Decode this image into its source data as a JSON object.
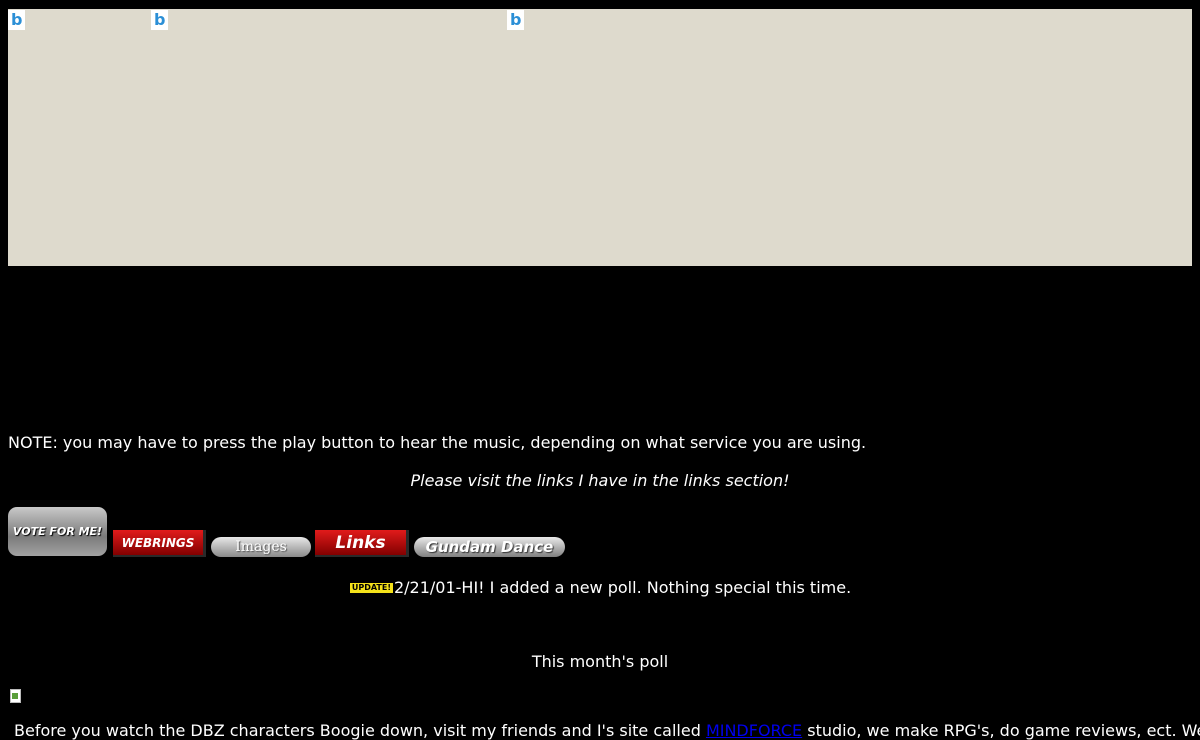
{
  "banner": {
    "background_color": "#dedacd",
    "icons": [
      "bing-icon",
      "bing-icon",
      "bing-icon"
    ],
    "icon_glyph": "b"
  },
  "note_text": "NOTE: you may have to press the play button to hear the music, depending on what service you are using.",
  "visit_text": "Please visit the links I have in the links section!",
  "nav_buttons": {
    "vote": "VOTE FOR ME!",
    "webrings": "WEBRINGS",
    "images": "Images",
    "links": "Links",
    "gundam": "Gundam Dance"
  },
  "update": {
    "badge": "UPDATE!",
    "text": "2/21/01-HI! I added a new poll. Nothing special this time."
  },
  "poll_title": "This month's poll",
  "bottom": {
    "before": "Before you watch the DBZ characters Boogie down, visit my friends and I's site called ",
    "link": "MINDFORCE",
    "after": " studio, we make RPG's, do game reviews, ect. We need"
  },
  "colors": {
    "page_background": "#000000",
    "text": "#ffffff",
    "link": "#0000ee",
    "button_red": "#c40c0c",
    "badge_yellow": "#f5e21a"
  }
}
